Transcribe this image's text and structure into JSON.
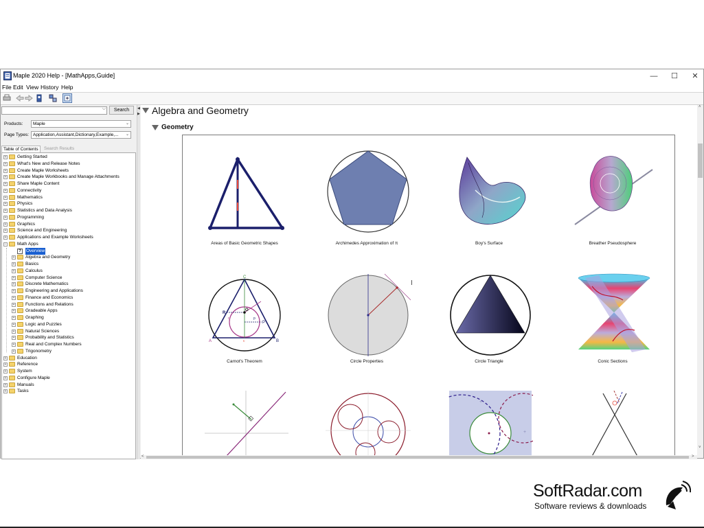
{
  "window": {
    "title": "Maple 2020 Help - [MathApps,Guide]",
    "minimize_glyph": "—",
    "maximize_glyph": "☐",
    "close_glyph": "✕"
  },
  "menu": [
    "File",
    "Edit",
    "View",
    "History",
    "Help"
  ],
  "toolbar": {
    "icons": [
      "print-icon",
      "back-icon",
      "forward-icon",
      "bookmark-icon",
      "toc-sync-icon",
      "zoom-icon"
    ]
  },
  "search": {
    "value": "",
    "button_label": "Search",
    "products_label": "Products:",
    "products_value": "Maple",
    "pagetypes_label": "Page Types:",
    "pagetypes_value": "Application,Assistant,Dictionary,Example,..."
  },
  "tabs": {
    "toc": "Table of Contents",
    "results": "Search Results"
  },
  "tree": {
    "top": [
      "Getting Started",
      "What's New and Release Notes",
      "Create Maple Worksheets",
      "Create Maple Workbooks and Manage Attachments",
      "Share Maple Content",
      "Connectivity",
      "Mathematics",
      "Physics",
      "Statistics and Data Analysis",
      "Programming",
      "Graphics",
      "Science and Engineering",
      "Applications and Example Worksheets",
      "Math Apps"
    ],
    "math_apps_children": [
      "Overview",
      "Algebra and Geometry",
      "Basics",
      "Calculus",
      "Computer Science",
      "Discrete Mathematics",
      "Engineering and Applications",
      "Finance and Economics",
      "Functions and Relations",
      "Gradeable Apps",
      "Graphing",
      "Logic and Puzzles",
      "Natural Sciences",
      "Probability and Statistics",
      "Real and Complex Numbers",
      "Trigonometry"
    ],
    "bottom": [
      "Education",
      "Reference",
      "System",
      "Configure Maple",
      "Manuals",
      "Tasks"
    ]
  },
  "content": {
    "heading": "Algebra and Geometry",
    "subheading": "Geometry",
    "apps": [
      "Areas of Basic Geometric Shapes",
      "Archimedes Approximation of π",
      "Boy's Surface",
      "Breather Pseudosphere",
      "Carnot's Theorem",
      "Circle Properties",
      "Circle Triangle",
      "Conic Sections"
    ],
    "carnot_letters": [
      "C",
      "O",
      "R",
      "P",
      "A",
      "B",
      "c",
      "p",
      "r"
    ]
  },
  "watermark": {
    "title": "SoftRadar.com",
    "subtitle": "Software reviews & downloads"
  },
  "colors": {
    "selection": "#1a5fd0",
    "folder": "#f4d26b",
    "triangle_navy": "#1b1f6b",
    "pentagon_fill": "#6e7fb0"
  }
}
